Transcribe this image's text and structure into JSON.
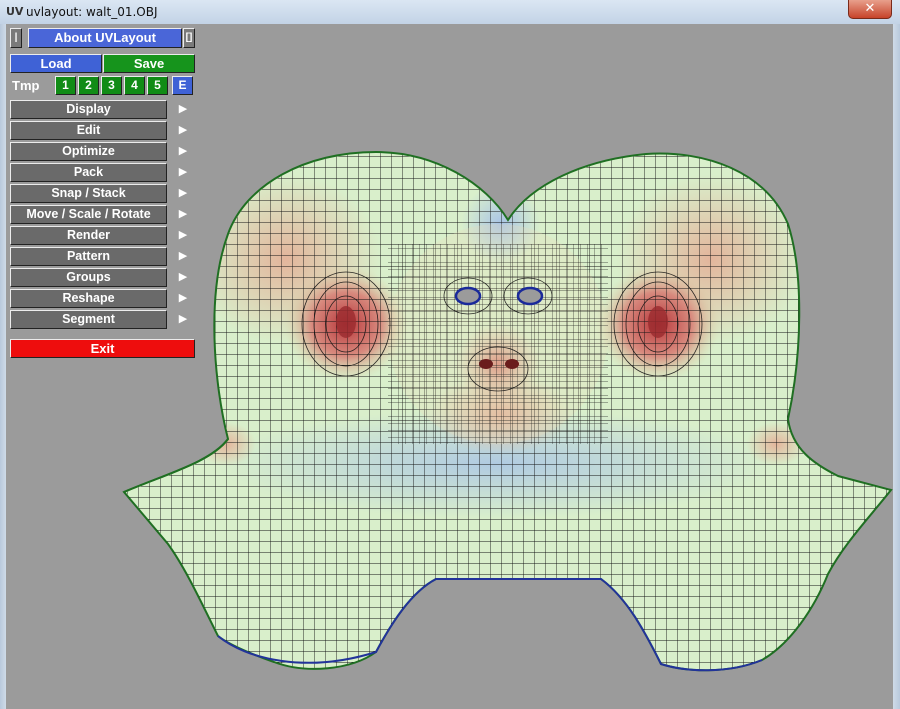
{
  "window": {
    "title": "uvlayout: walt_01.OBJ",
    "close_glyph": "✕",
    "app_icon": "uv-app-icon"
  },
  "panel": {
    "about": "About UVLayout",
    "pin_left": "|",
    "pin_right": "[]",
    "load": "Load",
    "save": "Save",
    "tmp_label": "Tmp",
    "tmp_slots": [
      "1",
      "2",
      "3",
      "4",
      "5",
      "E"
    ],
    "menu_items": [
      "Display",
      "Edit",
      "Optimize",
      "Pack",
      "Snap / Stack",
      "Move / Scale / Rotate",
      "Render",
      "Pattern",
      "Groups",
      "Reshape",
      "Segment"
    ],
    "arrow_glyph": "▶",
    "exit": "Exit"
  },
  "colors": {
    "about": "#4a66d8",
    "load": "#3f62d6",
    "save": "#16941c",
    "tmp": "#118c16",
    "menu": "#6a6a6a",
    "exit": "#ee0d0d",
    "viewport_bg": "#9b9b9b",
    "mesh_line": "#141414",
    "mesh_border": "#1a7a1a"
  }
}
